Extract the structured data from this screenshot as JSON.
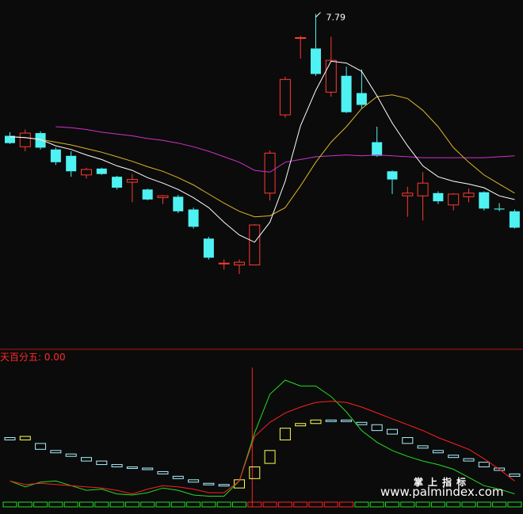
{
  "colors": {
    "background": "#0b0b0b",
    "up_candle": "#ff3b30",
    "down_candle": "#4ef2f2",
    "ma_fast": "#ffffff",
    "ma_mid": "#e0b52a",
    "ma_slow": "#cc33cc",
    "osc_red": "#ff2020",
    "osc_green": "#22dd22",
    "osc_box_cyan": "#a8f0ff",
    "osc_box_yellow": "#ffff55",
    "divider": "#b01515"
  },
  "chart_data": [
    {
      "type": "candlestick",
      "ylim": [
        5.0,
        7.9
      ],
      "max_price_label": "7.79",
      "candles": [
        {
          "o": 6.45,
          "h": 6.49,
          "l": 6.36,
          "c": 6.37
        },
        {
          "o": 6.33,
          "h": 6.52,
          "l": 6.28,
          "c": 6.48
        },
        {
          "o": 6.48,
          "h": 6.5,
          "l": 6.3,
          "c": 6.32
        },
        {
          "o": 6.3,
          "h": 6.32,
          "l": 6.13,
          "c": 6.16
        },
        {
          "o": 6.23,
          "h": 6.28,
          "l": 6.0,
          "c": 6.06
        },
        {
          "o": 6.02,
          "h": 6.1,
          "l": 5.98,
          "c": 6.08
        },
        {
          "o": 6.09,
          "h": 6.1,
          "l": 6.02,
          "c": 6.03
        },
        {
          "o": 6.0,
          "h": 6.01,
          "l": 5.86,
          "c": 5.88
        },
        {
          "o": 5.94,
          "h": 6.03,
          "l": 5.72,
          "c": 5.97
        },
        {
          "o": 5.86,
          "h": 5.87,
          "l": 5.74,
          "c": 5.75
        },
        {
          "o": 5.77,
          "h": 5.8,
          "l": 5.7,
          "c": 5.79
        },
        {
          "o": 5.78,
          "h": 5.8,
          "l": 5.6,
          "c": 5.62
        },
        {
          "o": 5.64,
          "h": 5.66,
          "l": 5.43,
          "c": 5.45
        },
        {
          "o": 5.32,
          "h": 5.34,
          "l": 5.09,
          "c": 5.11
        },
        {
          "o": 5.05,
          "h": 5.09,
          "l": 4.98,
          "c": 5.05
        },
        {
          "o": 5.03,
          "h": 5.09,
          "l": 4.93,
          "c": 5.06
        },
        {
          "o": 5.03,
          "h": 5.48,
          "l": 5.03,
          "c": 5.47
        },
        {
          "o": 5.82,
          "h": 6.29,
          "l": 5.74,
          "c": 6.26
        },
        {
          "o": 6.68,
          "h": 7.1,
          "l": 6.65,
          "c": 7.07
        },
        {
          "o": 7.53,
          "h": 7.55,
          "l": 7.3,
          "c": 7.53
        },
        {
          "o": 7.41,
          "h": 7.79,
          "l": 7.11,
          "c": 7.13
        },
        {
          "o": 6.93,
          "h": 7.54,
          "l": 6.88,
          "c": 7.28
        },
        {
          "o": 7.11,
          "h": 7.21,
          "l": 6.7,
          "c": 6.71
        },
        {
          "o": 6.92,
          "h": 7.18,
          "l": 6.75,
          "c": 6.79
        },
        {
          "o": 6.38,
          "h": 6.55,
          "l": 6.22,
          "c": 6.23
        },
        {
          "o": 6.06,
          "h": 6.07,
          "l": 5.81,
          "c": 5.97
        },
        {
          "o": 5.79,
          "h": 5.89,
          "l": 5.56,
          "c": 5.82
        },
        {
          "o": 5.79,
          "h": 6.05,
          "l": 5.52,
          "c": 5.93
        },
        {
          "o": 5.82,
          "h": 5.84,
          "l": 5.7,
          "c": 5.73
        },
        {
          "o": 5.69,
          "h": 5.82,
          "l": 5.63,
          "c": 5.81
        },
        {
          "o": 5.78,
          "h": 5.87,
          "l": 5.72,
          "c": 5.82
        },
        {
          "o": 5.83,
          "h": 5.84,
          "l": 5.63,
          "c": 5.65
        },
        {
          "o": 5.65,
          "h": 5.71,
          "l": 5.62,
          "c": 5.64
        },
        {
          "o": 5.62,
          "h": 5.64,
          "l": 5.43,
          "c": 5.44
        }
      ],
      "ma_fast": [
        6.44,
        6.43,
        6.41,
        6.34,
        6.3,
        6.24,
        6.19,
        6.12,
        6.07,
        5.99,
        5.93,
        5.86,
        5.77,
        5.66,
        5.5,
        5.36,
        5.28,
        5.5,
        5.95,
        6.56,
        6.95,
        7.27,
        7.25,
        7.16,
        6.89,
        6.59,
        6.34,
        6.12,
        6.0,
        5.95,
        5.92,
        5.88,
        5.79,
        5.75
      ],
      "ma_mid": [
        6.44,
        6.43,
        6.41,
        6.38,
        6.35,
        6.31,
        6.27,
        6.22,
        6.17,
        6.11,
        6.06,
        5.99,
        5.91,
        5.81,
        5.71,
        5.62,
        5.56,
        5.57,
        5.66,
        5.9,
        6.16,
        6.38,
        6.55,
        6.75,
        6.88,
        6.9,
        6.86,
        6.73,
        6.55,
        6.32,
        6.16,
        6.02,
        5.92,
        5.82
      ],
      "ma_slow": [
        null,
        null,
        null,
        6.55,
        6.54,
        6.52,
        6.49,
        6.47,
        6.45,
        6.42,
        6.4,
        6.37,
        6.33,
        6.28,
        6.22,
        6.16,
        6.07,
        6.05,
        6.16,
        6.19,
        6.22,
        6.23,
        6.24,
        6.23,
        6.24,
        6.23,
        6.22,
        6.21,
        6.21,
        6.21,
        6.21,
        6.21,
        6.22,
        6.23
      ]
    },
    {
      "type": "indicator",
      "label": "天百分五: 0.00",
      "ylim": [
        0,
        100
      ],
      "red": [
        14,
        11,
        12,
        11,
        10,
        9,
        8,
        6,
        3,
        7,
        10,
        9,
        7,
        4,
        4,
        14,
        52,
        64,
        72,
        77,
        81,
        82,
        81,
        77,
        72,
        67,
        62,
        57,
        51,
        46,
        41,
        33,
        24,
        14
      ],
      "green": [
        14,
        9,
        13,
        14,
        10,
        6,
        7,
        3,
        2,
        4,
        8,
        6,
        2,
        1,
        1,
        14,
        55,
        88,
        100,
        95,
        95,
        86,
        73,
        57,
        47,
        40,
        35,
        31,
        28,
        24,
        17,
        10,
        7,
        3
      ],
      "boxes": [
        {
          "top": 51,
          "bottom": 49,
          "color": "cyan"
        },
        {
          "top": 52,
          "bottom": 49,
          "color": "yellow"
        },
        {
          "top": 46,
          "bottom": 41,
          "color": "cyan"
        },
        {
          "top": 40,
          "bottom": 38,
          "color": "cyan"
        },
        {
          "top": 37,
          "bottom": 35,
          "color": "cyan"
        },
        {
          "top": 34,
          "bottom": 31,
          "color": "cyan"
        },
        {
          "top": 31,
          "bottom": 28,
          "color": "cyan"
        },
        {
          "top": 28,
          "bottom": 26,
          "color": "cyan"
        },
        {
          "top": 26,
          "bottom": 25,
          "color": "cyan"
        },
        {
          "top": 25,
          "bottom": 24,
          "color": "cyan"
        },
        {
          "top": 22,
          "bottom": 20,
          "color": "cyan"
        },
        {
          "top": 18,
          "bottom": 16,
          "color": "cyan"
        },
        {
          "top": 15,
          "bottom": 13,
          "color": "cyan"
        },
        {
          "top": 12,
          "bottom": 11,
          "color": "cyan"
        },
        {
          "top": 11,
          "bottom": 10,
          "color": "cyan"
        },
        {
          "top": 15,
          "bottom": 8,
          "color": "yellow"
        },
        {
          "top": 26,
          "bottom": 16,
          "color": "yellow"
        },
        {
          "top": 40,
          "bottom": 29,
          "color": "yellow"
        },
        {
          "top": 59,
          "bottom": 49,
          "color": "yellow"
        },
        {
          "top": 63,
          "bottom": 61,
          "color": "yellow"
        },
        {
          "top": 66,
          "bottom": 63,
          "color": "yellow"
        },
        {
          "top": 66,
          "bottom": 66,
          "color": "cyan"
        },
        {
          "top": 66,
          "bottom": 65,
          "color": "cyan"
        },
        {
          "top": 64,
          "bottom": 62,
          "color": "cyan"
        },
        {
          "top": 62,
          "bottom": 57,
          "color": "cyan"
        },
        {
          "top": 58,
          "bottom": 54,
          "color": "cyan"
        },
        {
          "top": 51,
          "bottom": 46,
          "color": "cyan"
        },
        {
          "top": 44,
          "bottom": 42,
          "color": "cyan"
        },
        {
          "top": 40,
          "bottom": 38,
          "color": "cyan"
        },
        {
          "top": 36,
          "bottom": 34,
          "color": "cyan"
        },
        {
          "top": 33,
          "bottom": 31,
          "color": "cyan"
        },
        {
          "top": 30,
          "bottom": 26,
          "color": "cyan"
        },
        {
          "top": 25,
          "bottom": 23,
          "color": "cyan"
        },
        {
          "top": 20,
          "bottom": 18,
          "color": "cyan"
        }
      ],
      "bottom_strip": [
        "green",
        "green",
        "green",
        "green",
        "green",
        "green",
        "green",
        "green",
        "green",
        "green",
        "green",
        "green",
        "green",
        "green",
        "green",
        "green",
        "red",
        "red",
        "red",
        "red",
        "red",
        "red",
        "red",
        "green",
        "green",
        "green",
        "green",
        "green",
        "green",
        "green",
        "green",
        "green",
        "green",
        "green"
      ],
      "signal_marker_index": 16
    }
  ],
  "watermark": {
    "cn": "掌上指标",
    "url": "www.palmindex.com"
  }
}
